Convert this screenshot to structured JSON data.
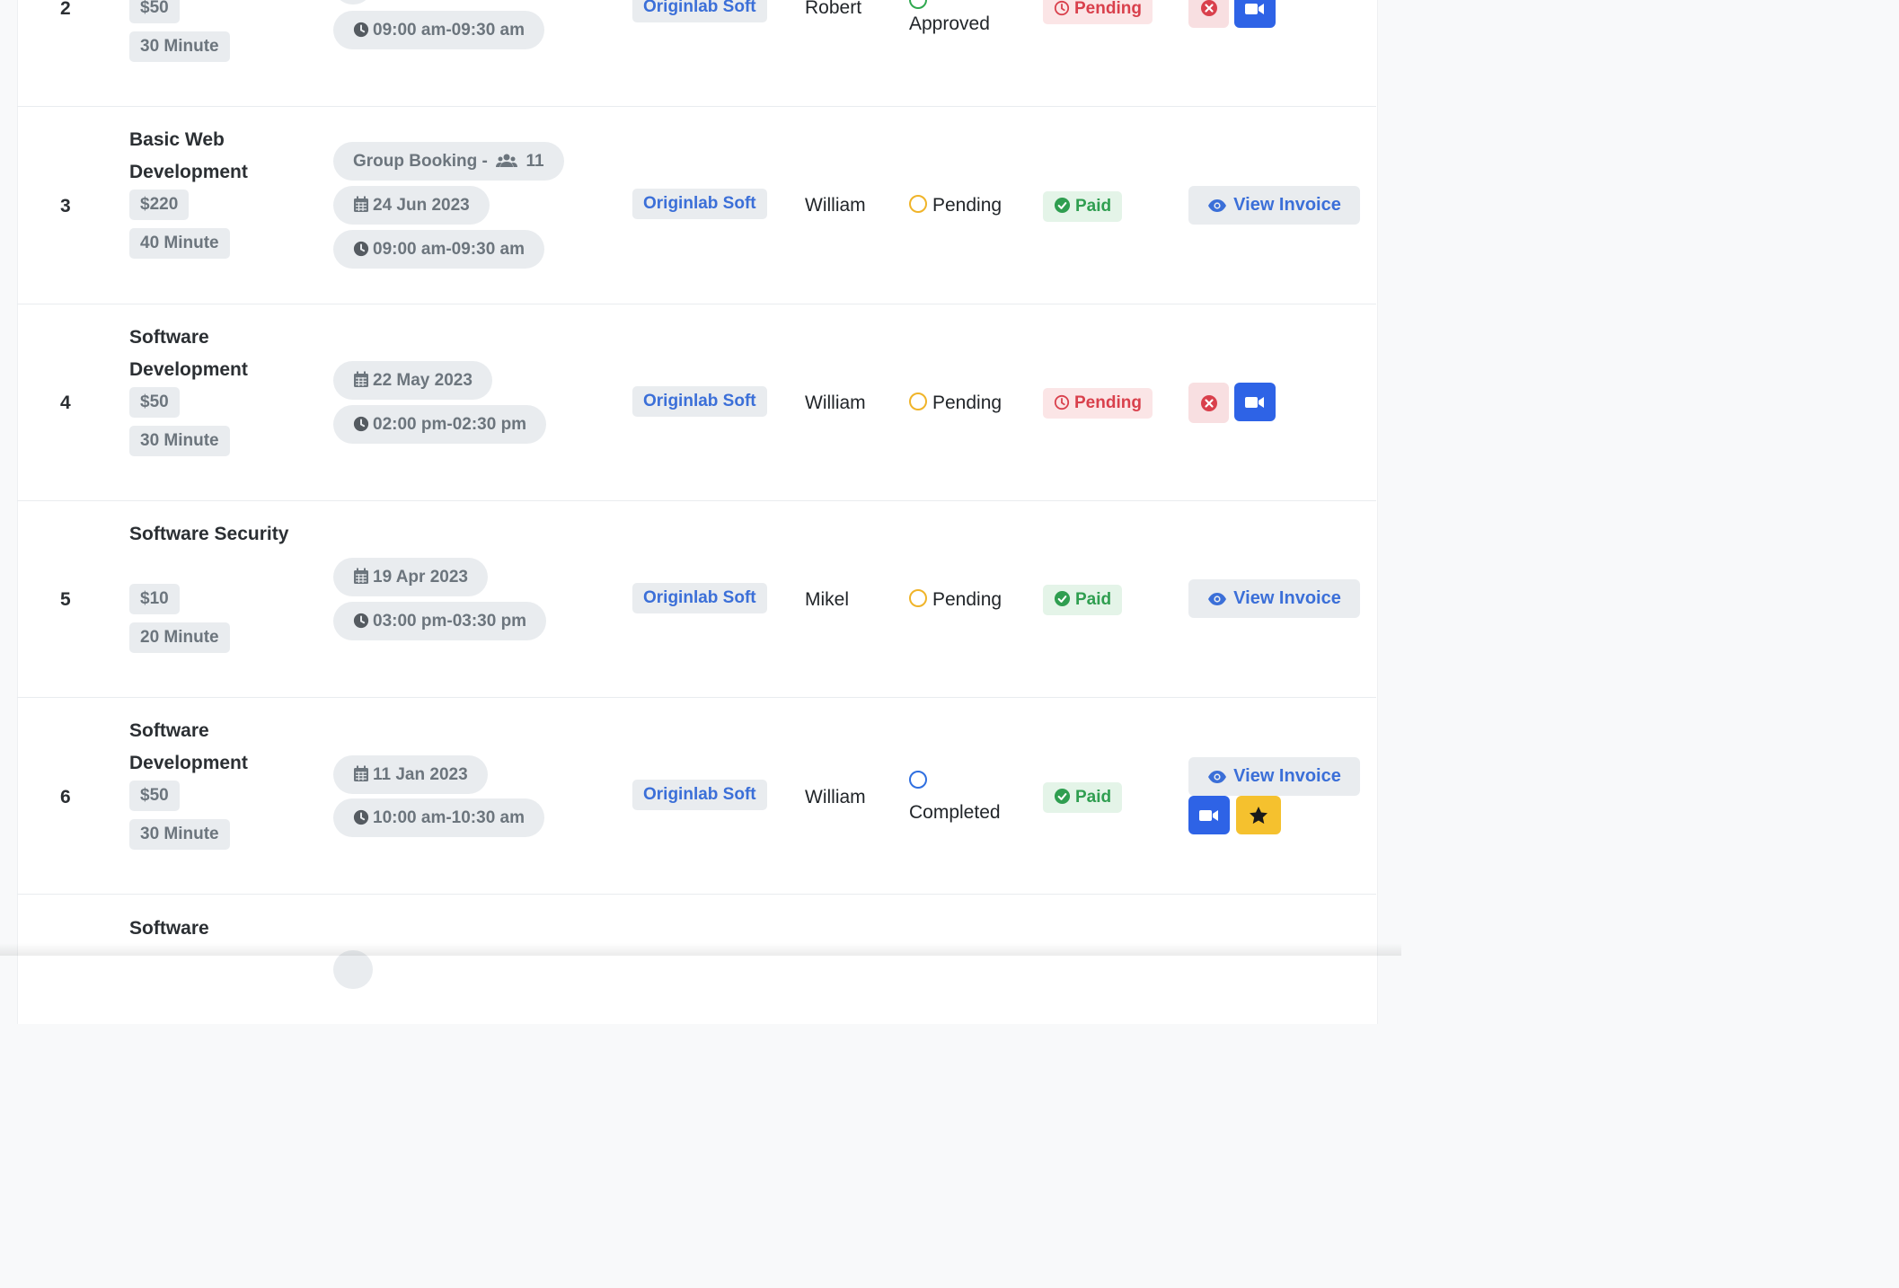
{
  "colors": {
    "primary": "#2e63e6",
    "paid_bg": "#e4f4e8",
    "paid_text": "#2f9e50",
    "pending_bg": "#fbe5e6",
    "pending_text": "#d9404c",
    "star": "#f5c12e"
  },
  "rows": [
    {
      "index": "2",
      "price": "$50",
      "duration": "30 Minute",
      "time": "09:00 am-09:30 am",
      "company": "Originlab Soft",
      "person": "Robert",
      "status": "Approved",
      "payment": "Pending",
      "status_icon": "green-ring-icon",
      "actions": [
        "cancel-icon",
        "video-icon"
      ]
    },
    {
      "index": "3",
      "title": "Basic Web Development",
      "price": "$220",
      "duration": "40 Minute",
      "group_booking": "Group Booking -",
      "group_count": "11",
      "date": "24 Jun 2023",
      "time": "09:00 am-09:30 am",
      "company": "Originlab Soft",
      "person": "William",
      "status": "Pending",
      "payment": "Paid",
      "action_label": "View Invoice"
    },
    {
      "index": "4",
      "title": "Software Development",
      "price": "$50",
      "duration": "30 Minute",
      "date": "22 May 2023",
      "time": "02:00 pm-02:30 pm",
      "company": "Originlab Soft",
      "person": "William",
      "status": "Pending",
      "payment": "Pending",
      "actions": [
        "cancel-icon",
        "video-icon"
      ]
    },
    {
      "index": "5",
      "title": "Software Security",
      "price": "$10",
      "duration": "20 Minute",
      "date": "19 Apr 2023",
      "time": "03:00 pm-03:30 pm",
      "company": "Originlab Soft",
      "person": "Mikel",
      "status": "Pending",
      "payment": "Paid",
      "action_label": "View Invoice"
    },
    {
      "index": "6",
      "title": "Software Development",
      "price": "$50",
      "duration": "30 Minute",
      "date": "11 Jan 2023",
      "time": "10:00 am-10:30 am",
      "company": "Originlab Soft",
      "person": "William",
      "status": "Completed",
      "payment": "Paid",
      "action_label": "View Invoice",
      "actions": [
        "video-icon",
        "star-icon"
      ]
    },
    {
      "title": "Software"
    }
  ]
}
